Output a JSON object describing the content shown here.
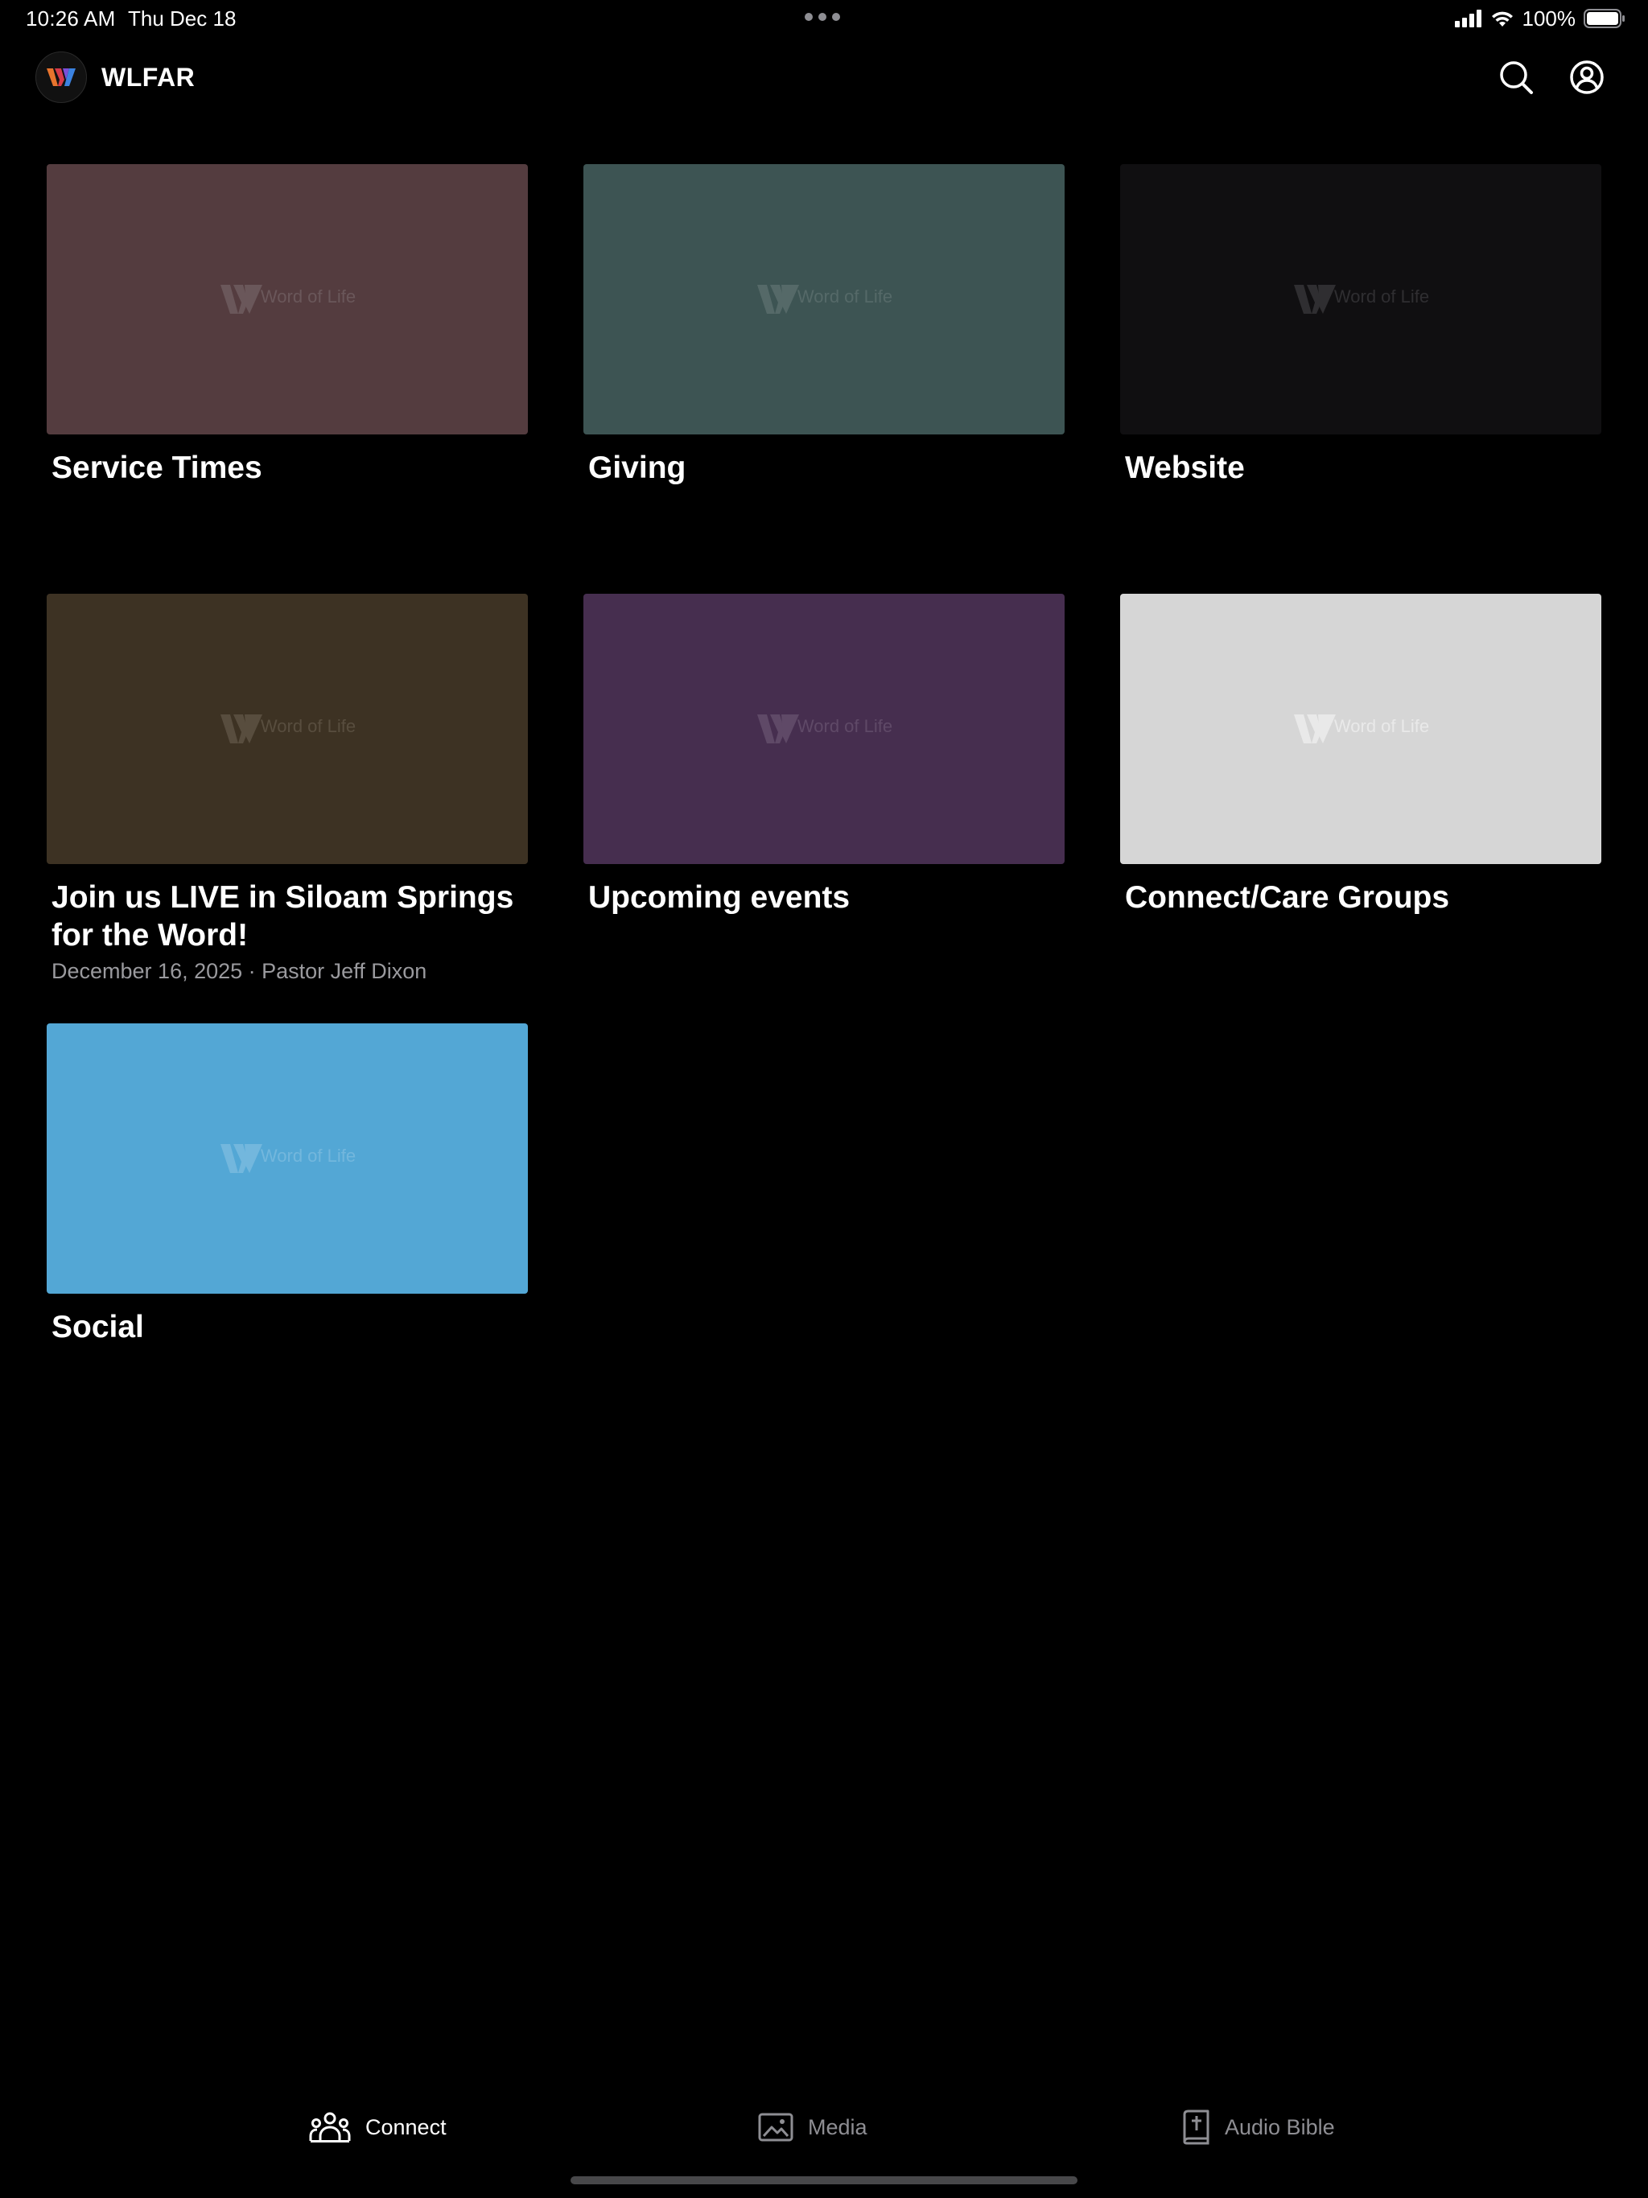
{
  "status_bar": {
    "time": "10:26 AM",
    "date": "Thu Dec 18",
    "battery_percent": "100%",
    "icons": [
      "cellular-signal-icon",
      "wifi-icon",
      "battery-icon"
    ]
  },
  "header": {
    "org_name": "WLFAR",
    "logo": "wlfar-logo",
    "actions": [
      "search-icon",
      "account-icon"
    ]
  },
  "cards": [
    {
      "title": "Service Times",
      "subtitle": "",
      "color": "#543c3f",
      "watermark": "Word of Life",
      "watermark_color": "#6d5a5d"
    },
    {
      "title": "Giving",
      "subtitle": "",
      "color": "#3d5453",
      "watermark": "Word of Life",
      "watermark_color": "#586c6b"
    },
    {
      "title": "Website",
      "subtitle": "",
      "color": "#100f11",
      "watermark": "Word of Life",
      "watermark_color": "#333235"
    },
    {
      "title": "Join us LIVE in Siloam Springs for the Word!",
      "subtitle": "December 16, 2025 · Pastor Jeff Dixon",
      "color": "#3d3223",
      "watermark": "Word of Life",
      "watermark_color": "#5b5142"
    },
    {
      "title": "Upcoming events",
      "subtitle": "",
      "color": "#462e4f",
      "watermark": "Word of Life",
      "watermark_color": "#624d6a"
    },
    {
      "title": "Connect/Care Groups",
      "subtitle": "",
      "color": "#d6d6d6",
      "watermark": "Word of Life",
      "watermark_color": "#ececec"
    },
    {
      "title": "Social",
      "subtitle": "",
      "color": "#53a7d5",
      "watermark": "Word of Life",
      "watermark_color": "#77b9de"
    }
  ],
  "tabs": [
    {
      "label": "Connect",
      "icon": "people-group-icon",
      "active": true
    },
    {
      "label": "Media",
      "icon": "image-icon",
      "active": false
    },
    {
      "label": "Audio Bible",
      "icon": "bible-book-icon",
      "active": false
    }
  ]
}
